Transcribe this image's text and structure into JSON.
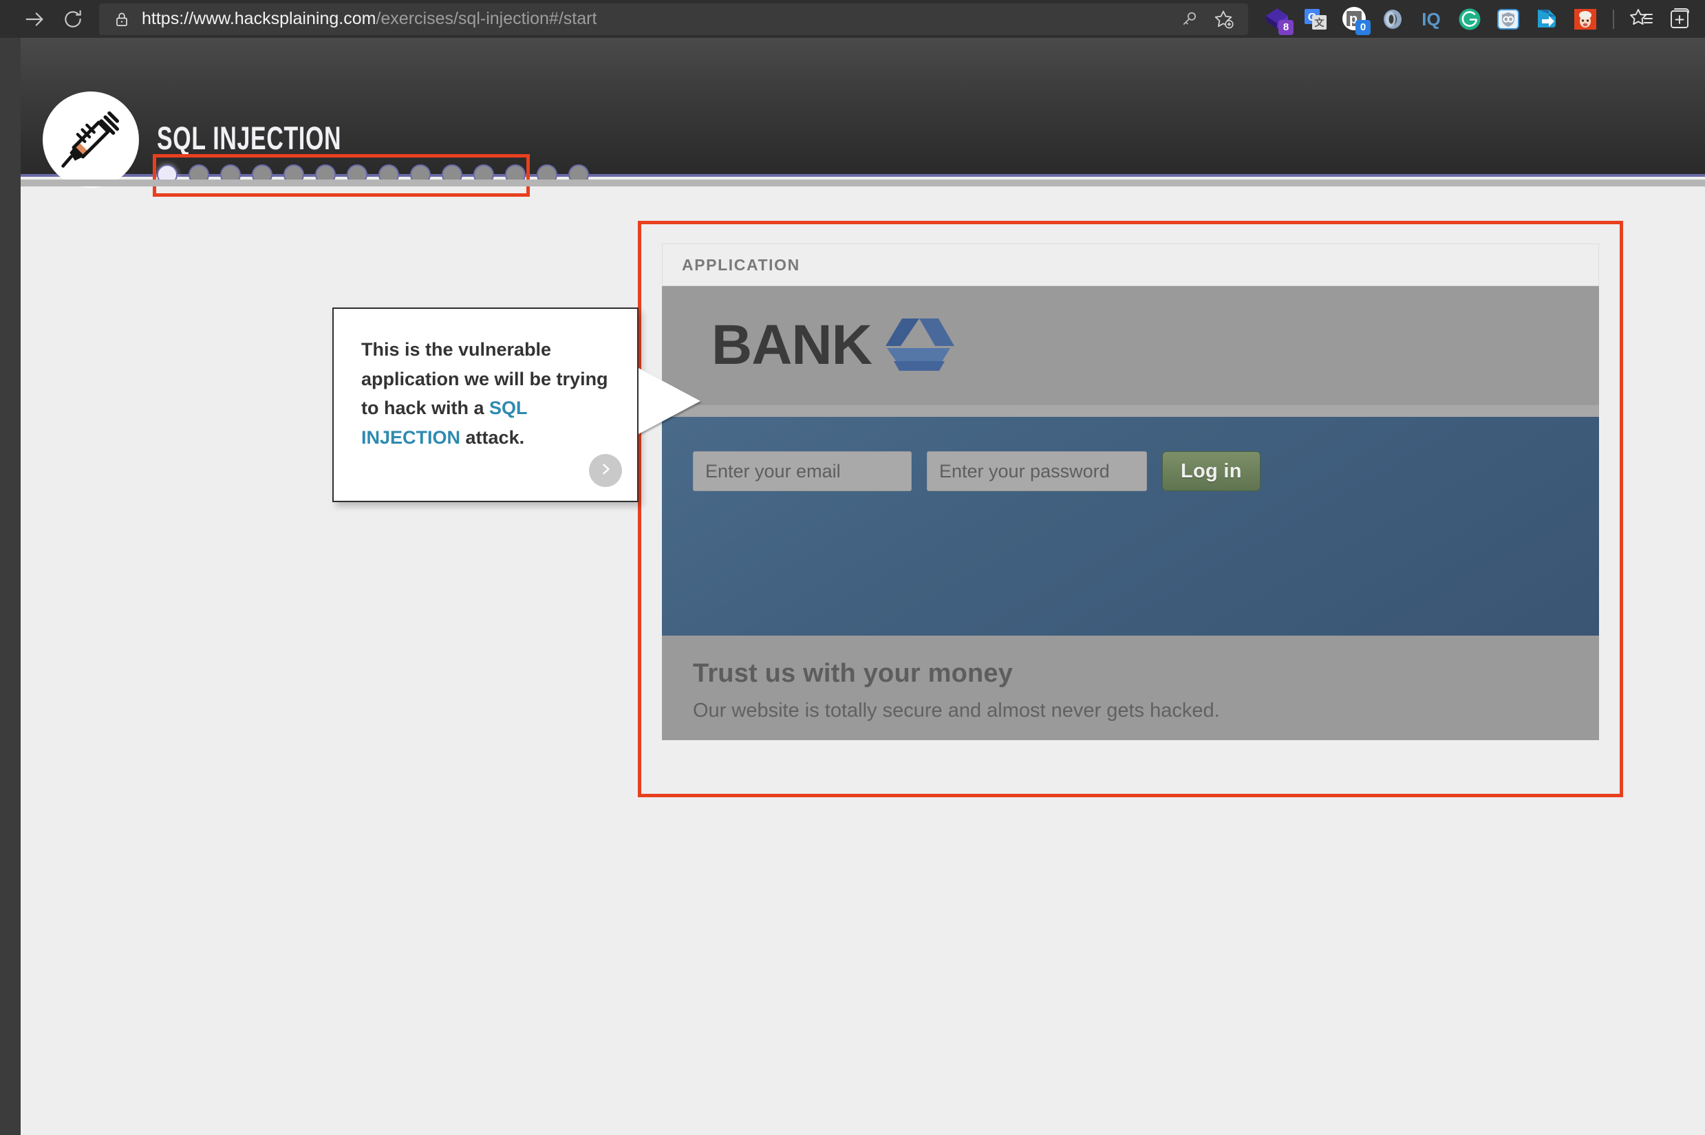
{
  "browser": {
    "nav": {
      "forward_icon": "arrow-right-icon",
      "reload_icon": "reload-icon"
    },
    "address": {
      "lock_icon": "lock-icon",
      "url_scheme_host": "https://www.hacksplaining.com",
      "url_path": "/exercises/sql-injection#/start",
      "full_url": "https://www.hacksplaining.com/exercises/sql-injection#/start",
      "key_icon": "key-icon",
      "add_favorite_icon": "star-add-icon"
    },
    "extensions": [
      {
        "name": "purple-diamond-extension-icon",
        "badge": "8",
        "badge_color": "#7b3fc4"
      },
      {
        "name": "google-translate-icon",
        "badge": "",
        "badge_color": ""
      },
      {
        "name": "pocket-extension-icon",
        "badge": "0",
        "badge_color": "#2a7de1"
      },
      {
        "name": "blue-ring-extension-icon",
        "badge": "",
        "badge_color": ""
      },
      {
        "name": "iq-extension-icon",
        "badge": "",
        "badge_color": ""
      },
      {
        "name": "grammarly-icon",
        "badge": "",
        "badge_color": ""
      },
      {
        "name": "shield-privacy-icon",
        "badge": "",
        "badge_color": ""
      },
      {
        "name": "save-to-blue-arrow-icon",
        "badge": "",
        "badge_color": ""
      },
      {
        "name": "red-character-extension-icon",
        "badge": "",
        "badge_color": ""
      }
    ],
    "toolbar_right": {
      "favorites_icon": "favorites-star-list-icon",
      "collections_icon": "collections-add-icon"
    }
  },
  "exercise": {
    "logo_icon": "syringe-icon",
    "title": "SQL INJECTION",
    "progress": {
      "total_steps": 14,
      "current_step": 1
    }
  },
  "callout": {
    "text_part1": "This is the vulnerable application we will be trying to hack with a ",
    "highlight": "SQL INJECTION",
    "text_part2": " attack.",
    "next_icon": "chevron-right-icon",
    "highlight_color": "#2e8ab0"
  },
  "application_panel": {
    "header_label": "APPLICATION",
    "bank": {
      "wordmark": "BANK",
      "logo_mark_icon": "bank-triangle-logo-icon",
      "logo_mark_color": "#4a699b",
      "login": {
        "email_placeholder": "Enter your email",
        "email_value": "",
        "password_placeholder": "Enter your password",
        "password_value": "",
        "submit_label": "Log in"
      },
      "tagline_heading": "Trust us with your money",
      "tagline_body": "Our website is totally secure and almost never gets hacked."
    }
  },
  "annotations": {
    "color": "#e8401f",
    "boxes": [
      "progress-dots-annotation",
      "application-panel-annotation"
    ]
  }
}
